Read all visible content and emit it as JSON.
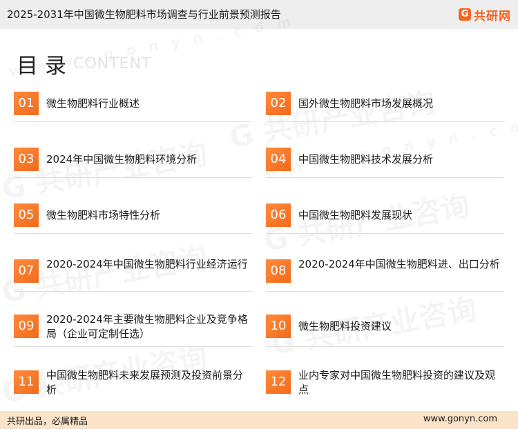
{
  "header": {
    "title": "2025-2031年中国微生物肥料市场调查与行业前景预测报告",
    "logo_mark": "G",
    "logo_text": "共研网"
  },
  "heading": {
    "cn": "目录",
    "en": "CONTENT"
  },
  "toc": [
    {
      "num": "01",
      "label": "微生物肥料行业概述"
    },
    {
      "num": "02",
      "label": "国外微生物肥料市场发展概况"
    },
    {
      "num": "03",
      "label": "2024年中国微生物肥料环境分析"
    },
    {
      "num": "04",
      "label": "中国微生物肥料技术发展分析"
    },
    {
      "num": "05",
      "label": "微生物肥料市场特性分析"
    },
    {
      "num": "06",
      "label": "中国微生物肥料发展现状"
    },
    {
      "num": "07",
      "label": "2020-2024年中国微生物肥料行业经济运行"
    },
    {
      "num": "08",
      "label": "2020-2024年中国微生物肥料进、出口分析"
    },
    {
      "num": "09",
      "label": "2020-2024年主要微生物肥料企业及竞争格局（企业可定制任选）"
    },
    {
      "num": "10",
      "label": "微生物肥料投资建议"
    },
    {
      "num": "11",
      "label": "中国微生物肥料未来发展预测及投资前景分析"
    },
    {
      "num": "12",
      "label": "业内专家对中国微生物肥料投资的建议及观点"
    }
  ],
  "footer": {
    "slogan": "共研出品，必属精品",
    "url": "www.gonyn.com"
  },
  "watermark": {
    "text": "G 共研产业咨询",
    "url": "w w w . g o n y n . c o m"
  },
  "colors": {
    "accent": "#f26a1b",
    "footer_bg": "#fbe3c9",
    "header_bg": "#eeeeee"
  }
}
